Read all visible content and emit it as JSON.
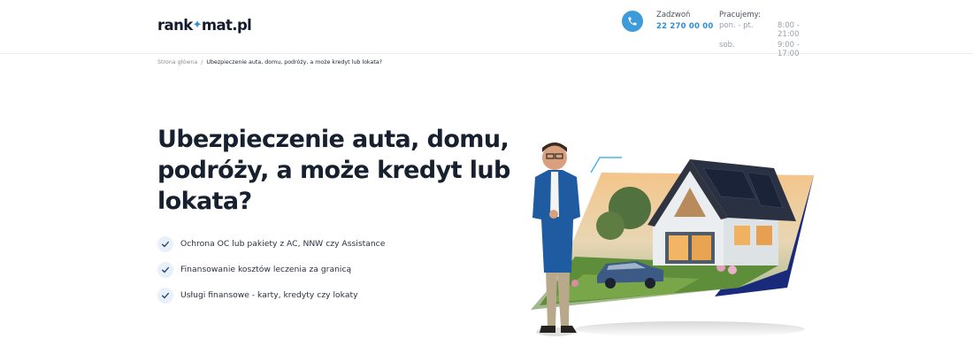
{
  "header": {
    "logo": {
      "left": "rank",
      "right": "mat.pl"
    },
    "call": {
      "label": "Zadzwoń",
      "number": "22 270 00 00"
    },
    "hours": {
      "title": "Pracujemy:",
      "rows": [
        {
          "days": "pon. - pt.",
          "time": "8:00 - 21:00"
        },
        {
          "days": "sob.",
          "time": "9:00 - 17:00"
        }
      ]
    }
  },
  "breadcrumb": {
    "home": "Strona główna",
    "separator": "/",
    "current": "Ubezpieczenie auta, domu, podróży, a może kredyt lub lokata?"
  },
  "hero": {
    "title_lines": [
      "Ubezpieczenie auta, domu,",
      "podróży, a może kredyt lub",
      "lokata?"
    ],
    "features": [
      "Ochrona OC lub pakiety z AC, NNW czy Assistance",
      "Finansowanie kosztów leczenia za granicą",
      "Usługi finansowe - karty, kredyty czy lokaty"
    ]
  },
  "icons": {
    "logo_mark": "star-icon",
    "phone": "phone-icon",
    "feature_check": "check-icon"
  },
  "colors": {
    "accent": "#2f8fd5",
    "check_bg": "#e8f0fa",
    "dark_navy": "#16202e"
  }
}
